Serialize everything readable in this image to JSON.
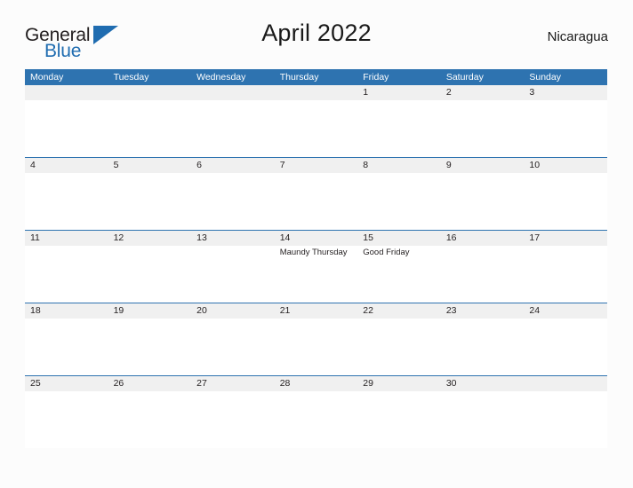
{
  "brand": {
    "name_part1": "General",
    "name_part2": "Blue",
    "accent_color": "#1f6cb0"
  },
  "header": {
    "title": "April 2022",
    "country": "Nicaragua"
  },
  "theme": {
    "header_blue": "#2e73b0",
    "band_grey": "#f0f0f0",
    "page_background": "#fcfcfc",
    "text_color": "#231f20"
  },
  "calendar": {
    "month": "April",
    "year": "2022",
    "weekday_headers": [
      "Monday",
      "Tuesday",
      "Wednesday",
      "Thursday",
      "Friday",
      "Saturday",
      "Sunday"
    ],
    "weeks": [
      [
        {
          "day": "",
          "events": []
        },
        {
          "day": "",
          "events": []
        },
        {
          "day": "",
          "events": []
        },
        {
          "day": "",
          "events": []
        },
        {
          "day": "1",
          "events": []
        },
        {
          "day": "2",
          "events": []
        },
        {
          "day": "3",
          "events": []
        }
      ],
      [
        {
          "day": "4",
          "events": []
        },
        {
          "day": "5",
          "events": []
        },
        {
          "day": "6",
          "events": []
        },
        {
          "day": "7",
          "events": []
        },
        {
          "day": "8",
          "events": []
        },
        {
          "day": "9",
          "events": []
        },
        {
          "day": "10",
          "events": []
        }
      ],
      [
        {
          "day": "11",
          "events": []
        },
        {
          "day": "12",
          "events": []
        },
        {
          "day": "13",
          "events": []
        },
        {
          "day": "14",
          "events": [
            "Maundy Thursday"
          ]
        },
        {
          "day": "15",
          "events": [
            "Good Friday"
          ]
        },
        {
          "day": "16",
          "events": []
        },
        {
          "day": "17",
          "events": []
        }
      ],
      [
        {
          "day": "18",
          "events": []
        },
        {
          "day": "19",
          "events": []
        },
        {
          "day": "20",
          "events": []
        },
        {
          "day": "21",
          "events": []
        },
        {
          "day": "22",
          "events": []
        },
        {
          "day": "23",
          "events": []
        },
        {
          "day": "24",
          "events": []
        }
      ],
      [
        {
          "day": "25",
          "events": []
        },
        {
          "day": "26",
          "events": []
        },
        {
          "day": "27",
          "events": []
        },
        {
          "day": "28",
          "events": []
        },
        {
          "day": "29",
          "events": []
        },
        {
          "day": "30",
          "events": []
        },
        {
          "day": "",
          "events": []
        }
      ]
    ]
  }
}
